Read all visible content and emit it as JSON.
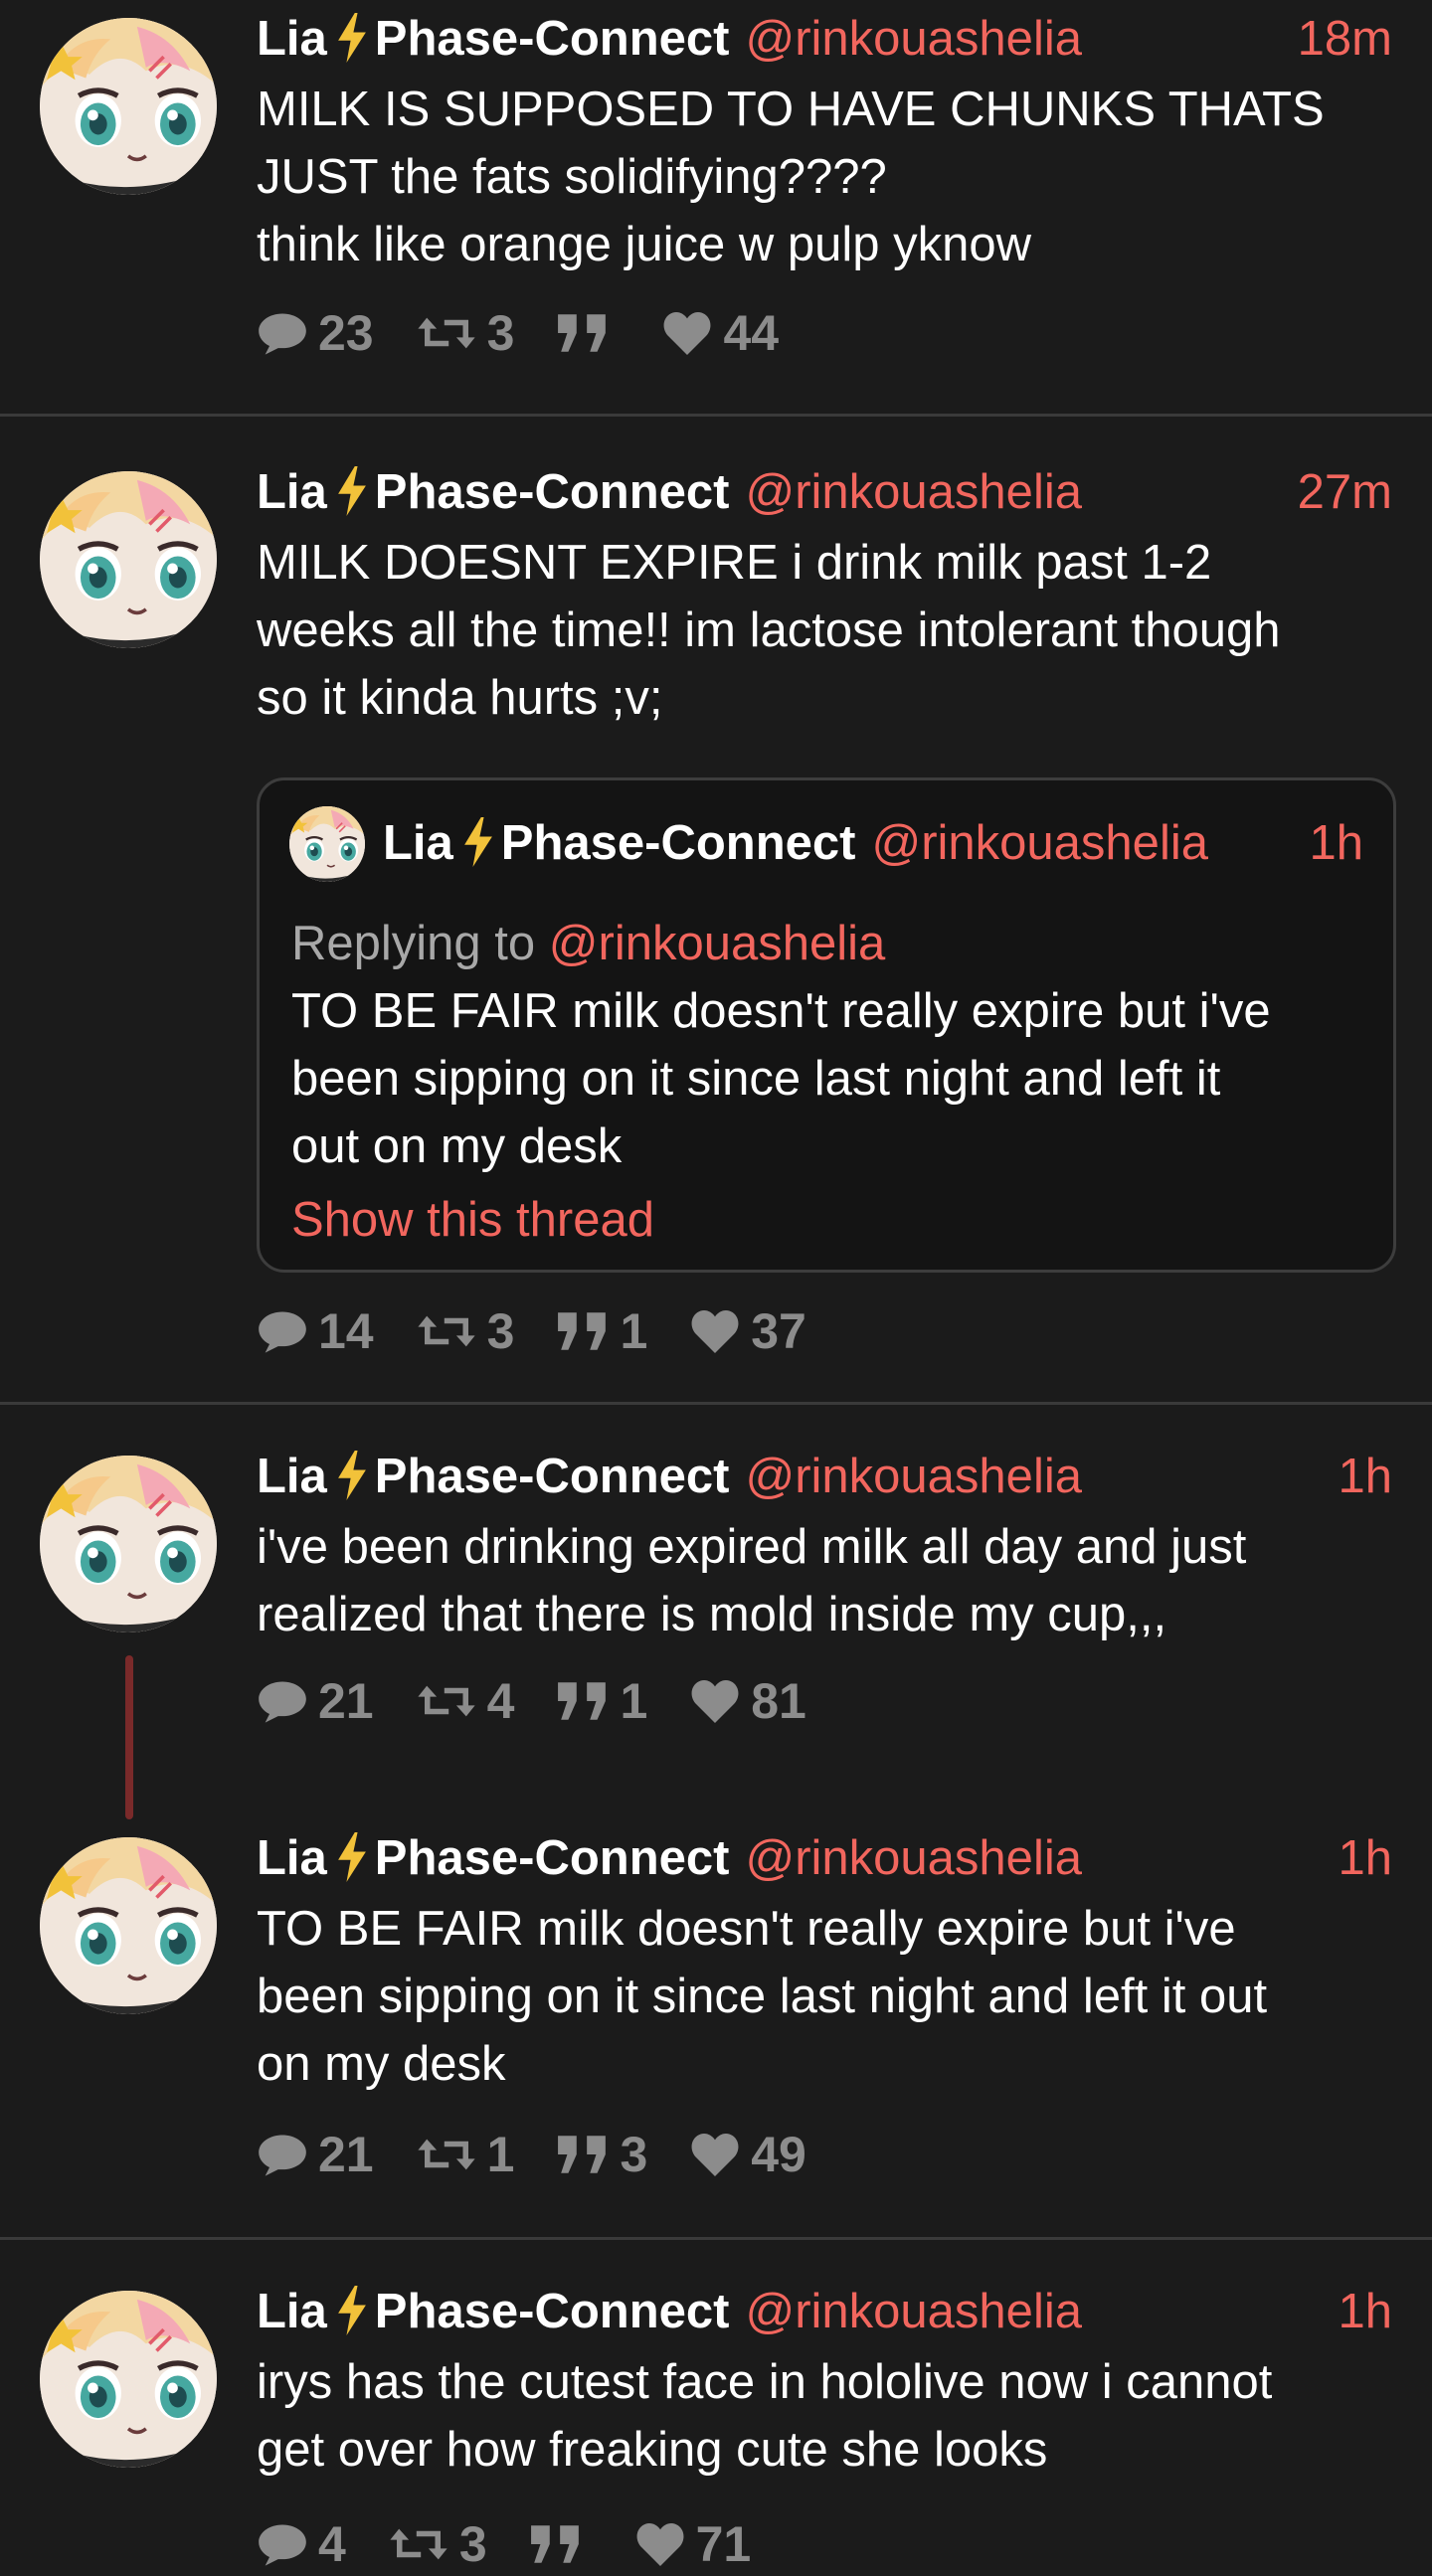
{
  "colors": {
    "background": "#1b1b1b",
    "accent": "#f2665e",
    "muted": "#8c8c8c",
    "divider": "#3a3a3a"
  },
  "icons": {
    "reply": "speech-bubble-icon",
    "retweet": "retweet-arrows-icon",
    "quote": "quote-marks-icon",
    "like": "heart-icon",
    "badge": "lightning-bolt-icon"
  },
  "tweets": [
    {
      "name": "Lia",
      "org": "Phase-Connect",
      "handle": "@rinkouashelia",
      "time": "18m",
      "lines": [
        "MILK IS SUPPOSED TO HAVE CHUNKS THATS",
        "JUST the fats solidifying????",
        "think like orange juice w pulp yknow"
      ],
      "replies": "23",
      "retweets": "3",
      "quotes": "",
      "likes": "44"
    },
    {
      "name": "Lia",
      "org": "Phase-Connect",
      "handle": "@rinkouashelia",
      "time": "27m",
      "lines": [
        "MILK DOESNT EXPIRE i drink milk past 1-2",
        "weeks all the time!! im lactose intolerant though",
        "so it kinda hurts ;v;"
      ],
      "quote": {
        "name": "Lia",
        "org": "Phase-Connect",
        "handle": "@rinkouashelia",
        "time": "1h",
        "replying_prefix": "Replying to ",
        "replying_handle": "@rinkouashelia",
        "lines": [
          "TO BE FAIR milk doesn't really expire but i've",
          "been sipping on it since last night and left it",
          "out on my desk"
        ],
        "show_thread": "Show this thread"
      },
      "replies": "14",
      "retweets": "3",
      "quotes": "1",
      "likes": "37"
    },
    {
      "name": "Lia",
      "org": "Phase-Connect",
      "handle": "@rinkouashelia",
      "time": "1h",
      "lines": [
        "i've been drinking expired milk all day and just",
        "realized that there is mold inside my cup,,,"
      ],
      "replies": "21",
      "retweets": "4",
      "quotes": "1",
      "likes": "81"
    },
    {
      "name": "Lia",
      "org": "Phase-Connect",
      "handle": "@rinkouashelia",
      "time": "1h",
      "lines": [
        "TO BE FAIR milk doesn't really expire but i've",
        "been sipping on it since last night and left it out",
        "on my desk"
      ],
      "replies": "21",
      "retweets": "1",
      "quotes": "3",
      "likes": "49"
    },
    {
      "name": "Lia",
      "org": "Phase-Connect",
      "handle": "@rinkouashelia",
      "time": "1h",
      "lines": [
        "irys has the cutest face in hololive now i cannot",
        "get over how freaking cute she looks"
      ],
      "replies": "4",
      "retweets": "3",
      "quotes": "",
      "likes": "71"
    }
  ]
}
